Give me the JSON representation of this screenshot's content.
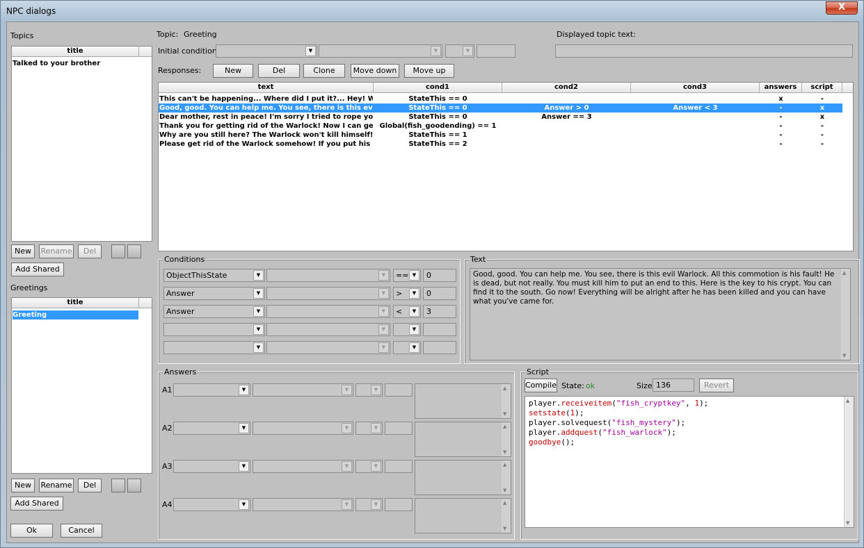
{
  "window": {
    "title": "NPC dialogs",
    "close_label": "X"
  },
  "topics": {
    "label": "Topics",
    "column": "title",
    "items": [
      "Talked to your brother"
    ],
    "new_label": "New",
    "rename_label": "Rename",
    "del_label": "Del",
    "add_shared_label": "Add Shared"
  },
  "greetings": {
    "label": "Greetings",
    "column": "title",
    "items": [
      "Greeting"
    ],
    "new_label": "New",
    "rename_label": "Rename",
    "del_label": "Del",
    "add_shared_label": "Add Shared"
  },
  "footer": {
    "ok_label": "Ok",
    "cancel_label": "Cancel"
  },
  "topic": {
    "label": "Topic:",
    "value": "Greeting",
    "initial_condition_label": "Initial condition:",
    "displayed_topic_label": "Displayed topic text:"
  },
  "responses": {
    "label": "Responses:",
    "buttons": {
      "new": "New",
      "del": "Del",
      "clone": "Clone",
      "move_down": "Move down",
      "move_up": "Move up"
    },
    "columns": [
      "text",
      "cond1",
      "cond2",
      "cond3",
      "answers",
      "script"
    ],
    "rows": [
      {
        "text": "This can't be happening... Where did I put it?... Hey! Who a",
        "cond1": "StateThis == 0",
        "cond2": "",
        "cond3": "",
        "answers": "x",
        "script": "-"
      },
      {
        "text": "Good, good. You can help me. You see, there is this evil War",
        "cond1": "StateThis == 0",
        "cond2": "Answer > 0",
        "cond3": "Answer < 3",
        "answers": "-",
        "script": "x"
      },
      {
        "text": "Dear mother, rest in peace! I'm sorry I tried to rope you in",
        "cond1": "StateThis == 0",
        "cond2": "Answer == 3",
        "cond3": "",
        "answers": "-",
        "script": "x"
      },
      {
        "text": "Thank you for getting rid of the Warlock! Now I can get back",
        "cond1": "Global(fish_goodending) == 1",
        "cond2": "",
        "cond3": "",
        "answers": "-",
        "script": "-"
      },
      {
        "text": "Why are you still here? The Warlock won't kill himself! Go!",
        "cond1": "StateThis == 1",
        "cond2": "",
        "cond3": "",
        "answers": "-",
        "script": "-"
      },
      {
        "text": "Please get rid of the Warlock somehow! If you put his spellb",
        "cond1": "StateThis == 2",
        "cond2": "",
        "cond3": "",
        "answers": "-",
        "script": "-"
      }
    ]
  },
  "conditions": {
    "label": "Conditions",
    "rows": [
      {
        "type": "ObjectThisState",
        "op": "==",
        "value": "0"
      },
      {
        "type": "Answer",
        "op": ">",
        "value": "0"
      },
      {
        "type": "Answer",
        "op": "<",
        "value": "3"
      },
      {
        "type": "",
        "op": "",
        "value": ""
      },
      {
        "type": "",
        "op": "",
        "value": ""
      }
    ]
  },
  "text": {
    "label": "Text",
    "body": "Good, good. You can help me. You see, there is this evil Warlock. All this commotion is his fault! He is dead, but not really. You must kill him to put an end to this. Here is the key to his crypt. You can find it to the south. Go now! Everything will be alright after he has been killed and you can have what you've came for."
  },
  "answers": {
    "label": "Answers",
    "rows": [
      "A1",
      "A2",
      "A3",
      "A4"
    ]
  },
  "script": {
    "label": "Script",
    "compile_label": "Compile",
    "state_label": "State:",
    "state_value": "ok",
    "state_color": "#2a8a2a",
    "size_label": "Size:",
    "size_value": "136",
    "revert_label": "Revert",
    "lines": [
      [
        [
          "player.",
          "obj"
        ],
        [
          "receiveitem",
          "fn"
        ],
        [
          "(",
          "obj"
        ],
        [
          "\"fish_cryptkey\"",
          "str"
        ],
        [
          ", ",
          "obj"
        ],
        [
          "1",
          "num"
        ],
        [
          ");",
          "obj"
        ]
      ],
      [
        [
          "setstate",
          "fn"
        ],
        [
          "(",
          "obj"
        ],
        [
          "1",
          "num"
        ],
        [
          ");",
          "obj"
        ]
      ],
      [
        [
          "player.",
          "obj"
        ],
        [
          "solvequest",
          "obj"
        ],
        [
          "(",
          "obj"
        ],
        [
          "\"fish_mystery\"",
          "str"
        ],
        [
          ");",
          "obj"
        ]
      ],
      [
        [
          "player.",
          "obj"
        ],
        [
          "addquest",
          "fn"
        ],
        [
          "(",
          "obj"
        ],
        [
          "\"fish_warlock\"",
          "str"
        ],
        [
          ");",
          "obj"
        ]
      ],
      [
        [
          "goodbye",
          "fn"
        ],
        [
          "();",
          "obj"
        ]
      ]
    ]
  },
  "colors": {
    "selection": "#3399ff",
    "client_bg": "#c0c0c0"
  }
}
